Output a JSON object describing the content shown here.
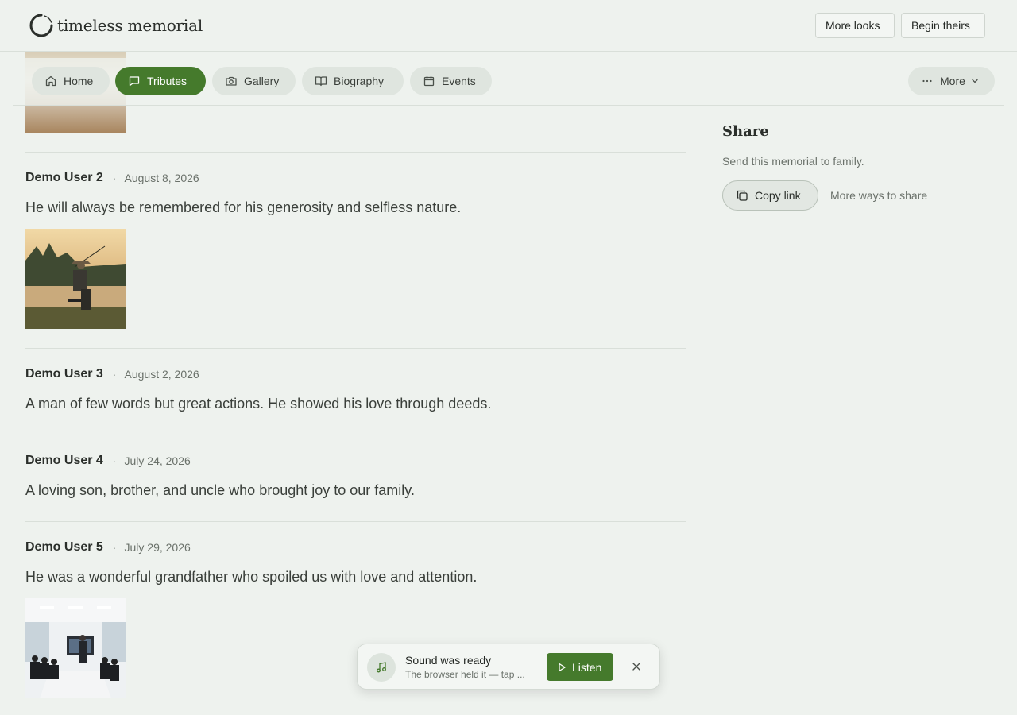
{
  "brand": {
    "name": "timeless memorial"
  },
  "header": {
    "more_looks": "More looks",
    "begin_theirs": "Begin theirs"
  },
  "nav": {
    "home": "Home",
    "tributes": "Tributes",
    "gallery": "Gallery",
    "biography": "Biography",
    "events": "Events",
    "more": "More",
    "active": "Tributes"
  },
  "tributes": [
    {
      "author": "Demo User 2",
      "date": "August 8, 2026",
      "message": "He will always be remembered for his generosity and selfless nature.",
      "has_photo": true
    },
    {
      "author": "Demo User 3",
      "date": "August 2, 2026",
      "message": "A man of few words but great actions. He showed his love through deeds.",
      "has_photo": false
    },
    {
      "author": "Demo User 4",
      "date": "July 24, 2026",
      "message": "A loving son, brother, and uncle who brought joy to our family.",
      "has_photo": false
    },
    {
      "author": "Demo User 5",
      "date": "July 29, 2026",
      "message": "He was a wonderful grandfather who spoiled us with love and attention.",
      "has_photo": true
    }
  ],
  "share": {
    "title": "Share",
    "subtitle": "Send this memorial to family.",
    "copy_link": "Copy link",
    "more_ways": "More ways to share"
  },
  "toast": {
    "title": "Sound was ready",
    "subtitle": "The browser held it — tap ...",
    "listen": "Listen"
  },
  "colors": {
    "accent": "#457a2c",
    "background": "#eef2ee"
  }
}
